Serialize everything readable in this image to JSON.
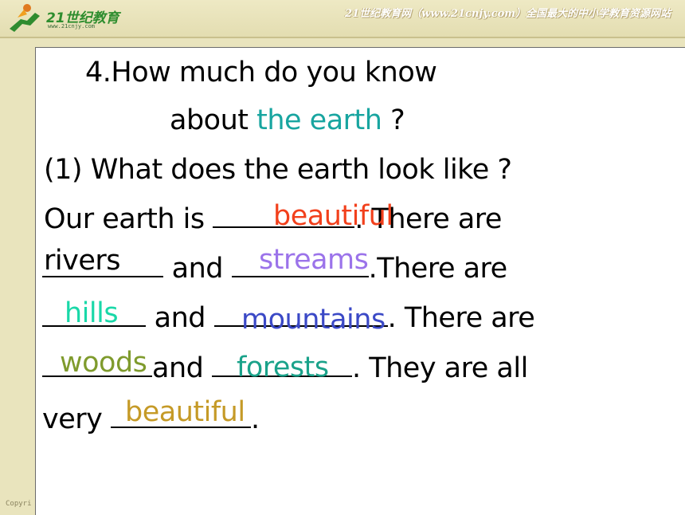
{
  "header": {
    "logo_text": "21世纪教育",
    "logo_url": "www.21cnjy.com",
    "site_caption": "21世纪教育网（www.21cnjy.com）全国最大的中小学教育资源网站"
  },
  "footer": {
    "copyright": "Copyri"
  },
  "slide": {
    "title_line1": "4.How much do you know",
    "title_line2_prefix": "about ",
    "title_line2_highlight": "the earth",
    "title_line2_suffix": " ?",
    "question": "(1) What does the earth look like ?",
    "line1_a": " Our earth is ",
    "line1_b": ". There are",
    "line2_word": "rivers",
    "line2_a": " and ",
    "line2_b": ".There are",
    "line3_a": " and ",
    "line3_b": ". There are",
    "line4_a": "and ",
    "line4_b": ". They are all",
    "line5_a": "very ",
    "line5_b": "."
  },
  "answers": {
    "a1": "beautiful",
    "a2": "streams",
    "a3": "hills",
    "a4": "mountains",
    "a5": "woods",
    "a6": "forests",
    "a7": "beautiful"
  },
  "colors": {
    "a1": "#f2401c",
    "a2": "#9b73ea",
    "a3": "#19d8a8",
    "a4": "#3b49c6",
    "a5": "#7f9b2d",
    "a6": "#1aa28a",
    "a7": "#c59a27",
    "highlight": "#18a5a0"
  }
}
